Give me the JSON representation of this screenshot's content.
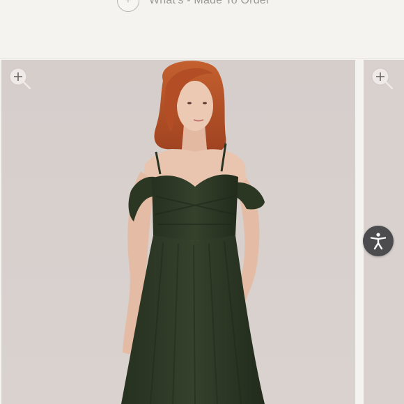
{
  "header": {
    "note_text": "What's - Made To Order",
    "note_icon": "info-icon"
  },
  "gallery": {
    "main_image": {
      "alt": "Woman with red hair wearing an off-shoulder dark green pleated bridesmaid dress",
      "zoom_icon": "zoom-in-icon"
    },
    "next_image": {
      "zoom_icon": "zoom-in-icon"
    }
  },
  "accessibility": {
    "icon": "accessibility-icon"
  },
  "colors": {
    "page_bg": "#f4f3ef",
    "photo_bg": "#d8d1ce",
    "dress": "#2f3a26",
    "hair": "#b9542c",
    "skin": "#e9c4ae",
    "a11y_bg": "#4c4c4e"
  }
}
